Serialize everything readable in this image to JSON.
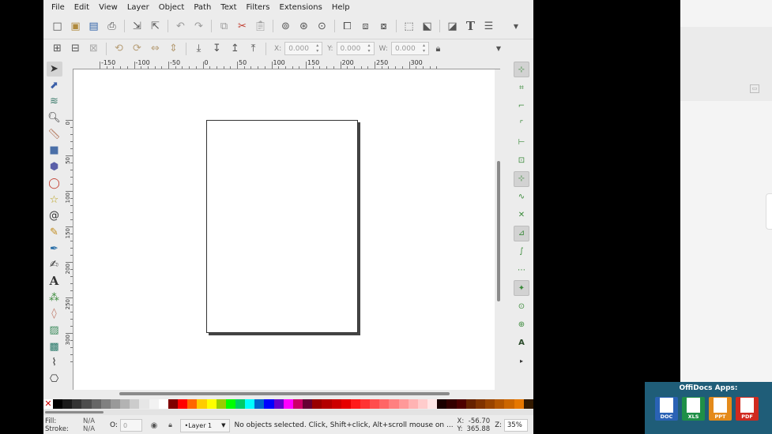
{
  "menubar": [
    "File",
    "Edit",
    "View",
    "Layer",
    "Object",
    "Path",
    "Text",
    "Filters",
    "Extensions",
    "Help"
  ],
  "commands": [
    "new-icon",
    "open-icon",
    "save-icon",
    "print-icon",
    "import-icon",
    "export-icon",
    "undo-icon",
    "redo-icon",
    "copy-icon",
    "cut-icon",
    "paste-icon",
    "zoom-selection-icon",
    "zoom-drawing-icon",
    "zoom-page-icon",
    "duplicate-icon",
    "clone-icon",
    "unlink-clone-icon",
    "group-icon",
    "ungroup-icon",
    "fill-stroke-icon",
    "text-font-icon",
    "layers-icon",
    "more-icon"
  ],
  "controls": {
    "x_label": "X:",
    "x_value": "0.000",
    "y_label": "Y:",
    "y_value": "0.000",
    "w_label": "W:",
    "w_value": "0.000"
  },
  "tools": [
    "selector-icon",
    "node-editor-icon",
    "tweak-icon",
    "zoom-icon",
    "measure-icon",
    "rectangle-icon",
    "3d-box-icon",
    "ellipse-icon",
    "star-icon",
    "spiral-icon",
    "pencil-icon",
    "pen-icon",
    "calligraphy-icon",
    "text-icon",
    "spray-icon",
    "eraser-icon",
    "bucket-fill-icon",
    "gradient-icon",
    "dropper-icon",
    "connector-icon"
  ],
  "ruler_h_labels": [
    "-150",
    "-100",
    "-50",
    "0",
    "50",
    "100",
    "150",
    "200",
    "250",
    "300"
  ],
  "ruler_v_labels": [
    "0",
    "50",
    "100",
    "150",
    "200",
    "250",
    "300"
  ],
  "snap_controls": [
    "snap-toggle-icon",
    "snap-bbox-icon",
    "snap-bbox-edge-icon",
    "snap-bbox-corner-icon",
    "snap-bbox-midpoint-icon",
    "snap-bbox-center-icon",
    "snap-nodes-icon",
    "snap-path-icon",
    "snap-intersection-icon",
    "snap-cusp-node-icon",
    "snap-smooth-node-icon",
    "snap-line-midpoint-icon",
    "snap-others-icon",
    "snap-center-icon",
    "snap-rotation-center-icon",
    "snap-text-baseline-icon",
    "snap-more-icon"
  ],
  "palette_colors": [
    "#000000",
    "#1a1a1a",
    "#333333",
    "#4d4d4d",
    "#666666",
    "#808080",
    "#999999",
    "#b3b3b3",
    "#cccccc",
    "#e6e6e6",
    "#f2f2f2",
    "#ffffff",
    "#800000",
    "#ff0000",
    "#ff6600",
    "#ffcc00",
    "#ffff00",
    "#99cc00",
    "#00ff00",
    "#00cc66",
    "#00ffff",
    "#0066cc",
    "#0000ff",
    "#6600cc",
    "#ff00ff",
    "#cc0066",
    "#660033",
    "#990000",
    "#b30000",
    "#cc0000",
    "#e60000",
    "#ff1a1a",
    "#ff3333",
    "#ff4d4d",
    "#ff6666",
    "#ff8080",
    "#ff9999",
    "#ffb3b3",
    "#ffcccc",
    "#ffe6e6",
    "#1a0000",
    "#330000",
    "#4d0000",
    "#662200",
    "#803300",
    "#994400",
    "#b35500",
    "#cc6600",
    "#e67700",
    "#331a00"
  ],
  "status": {
    "fill_label": "Fill:",
    "fill_value": "N/A",
    "stroke_label": "Stroke:",
    "stroke_value": "N/A",
    "opacity_label": "O:",
    "opacity_value": "0",
    "layer": "•Layer 1",
    "message": "No objects selected. Click, Shift+click, Alt+scroll mouse on ...",
    "x_label": "X:",
    "x_value": "-56.70",
    "y_label": "Y:",
    "y_value": "365.88",
    "zoom_label": "Z:",
    "zoom_value": "35%"
  },
  "offidocs": {
    "title": "OffiDocs Apps:",
    "apps": [
      "DOC",
      "XLS",
      "PPT",
      "PDF"
    ]
  }
}
